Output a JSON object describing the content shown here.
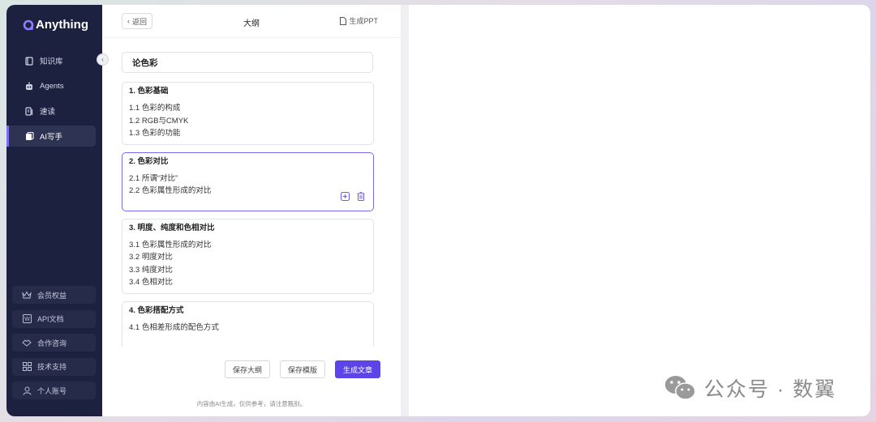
{
  "app": {
    "name": "Anything"
  },
  "sidebar": {
    "items": [
      {
        "label": "知识库",
        "icon": "book-icon"
      },
      {
        "label": "Agents",
        "icon": "robot-icon"
      },
      {
        "label": "速读",
        "icon": "reading-icon"
      },
      {
        "label": "AI写手",
        "icon": "write-icon",
        "active": true
      }
    ],
    "bottom_items": [
      {
        "label": "会员权益",
        "icon": "crown-icon"
      },
      {
        "label": "API文档",
        "icon": "document-w-icon"
      },
      {
        "label": "合作咨询",
        "icon": "handshake-icon"
      },
      {
        "label": "技术支持",
        "icon": "grid-icon"
      },
      {
        "label": "个人账号",
        "icon": "user-icon"
      }
    ]
  },
  "header": {
    "back_label": "返回",
    "title": "大纲",
    "ppt_label": "生成PPT"
  },
  "outline": {
    "title": "论色彩",
    "sections": [
      {
        "heading": "1. 色彩基础",
        "items": [
          "1.1 色彩的构成",
          "1.2 RGB与CMYK",
          "1.3 色彩的功能"
        ]
      },
      {
        "heading": "2. 色彩对比",
        "items": [
          "2.1 所谓“对比”",
          "2.2 色彩属性形成的对比"
        ],
        "active": true
      },
      {
        "heading": "3. 明度、纯度和色相对比",
        "items": [
          "3.1 色彩属性形成的对比",
          "3.2 明度对比",
          "3.3 纯度对比",
          "3.4 色相对比"
        ]
      },
      {
        "heading": "4. 色彩搭配方式",
        "items": [
          "4.1 色相差形成的配色方式"
        ]
      }
    ]
  },
  "footer": {
    "save_outline": "保存大纲",
    "save_template": "保存模版",
    "generate_article": "生成文章",
    "disclaimer": "内容由AI生成，仅供参考，请注意甄别。"
  },
  "watermark": {
    "text": "公众号 · 数翼"
  },
  "colors": {
    "accent": "#5b45e8",
    "sidebar_bg": "#1c2140",
    "active_border": "#7b6bef"
  }
}
